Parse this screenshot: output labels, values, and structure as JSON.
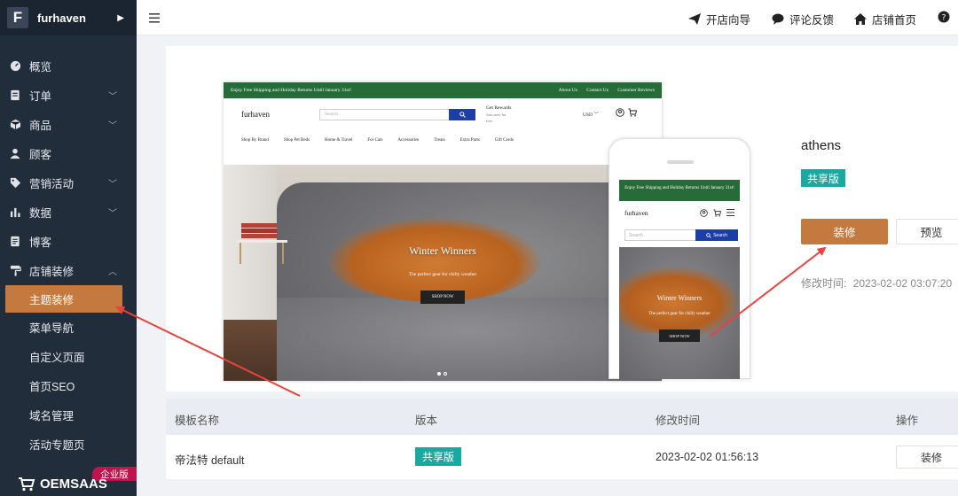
{
  "brand": {
    "logo_letter": "F",
    "name": "furhaven"
  },
  "sidebar": {
    "items": [
      {
        "label": "概览",
        "icon": "dashboard-icon",
        "has_chevron": false
      },
      {
        "label": "订单",
        "icon": "orders-icon",
        "has_chevron": true
      },
      {
        "label": "商品",
        "icon": "products-icon",
        "has_chevron": true
      },
      {
        "label": "顾客",
        "icon": "customers-icon",
        "has_chevron": false
      },
      {
        "label": "营销活动",
        "icon": "marketing-tag-icon",
        "has_chevron": true
      },
      {
        "label": "数据",
        "icon": "data-chart-icon",
        "has_chevron": true
      },
      {
        "label": "博客",
        "icon": "blog-icon",
        "has_chevron": false
      },
      {
        "label": "店铺装修",
        "icon": "paint-roller-icon",
        "has_chevron": true,
        "expanded": true
      }
    ],
    "sub_items": [
      "主题装修",
      "菜单导航",
      "自定义页面",
      "首页SEO",
      "域名管理",
      "活动专题页"
    ],
    "active_sub": "主题装修",
    "enterprise_badge": "企业版",
    "footer_logo": "OEMSAAS"
  },
  "topbar": {
    "links": [
      "开店向导",
      "评论反馈",
      "店铺首页"
    ]
  },
  "preview": {
    "desktop": {
      "announcement": "Enjoy Free Shipping and Holiday Returns Until January 31st!",
      "top_links": [
        "About Us",
        "Contact Us",
        "Customer Reviews"
      ],
      "store_name": "furhaven",
      "search_placeholder": "Search",
      "rewards_title": "Get Rewards",
      "rewards_sub": "Join now for",
      "rewards_sub2": "free",
      "currency": "USD",
      "nav": [
        "Shop By Brand",
        "Shop Pet Beds",
        "Home & Travel",
        "For Cats",
        "Accessories",
        "Treats",
        "Extra Parts",
        "Gift Cards"
      ],
      "hero_title": "Winter Winners",
      "hero_sub": "The perfect gear for chilly weather",
      "hero_button": "SHOP NOW"
    },
    "mobile": {
      "announcement": "Enjoy Free Shipping and Holiday Returns Until January 31st!",
      "store_name": "furhaven",
      "search_placeholder": "Search",
      "search_button": "Search",
      "hero_title": "Winter Winners",
      "hero_sub": "The perfect gear for chilly weather",
      "hero_button": "SHOP NOW"
    }
  },
  "theme": {
    "name": "athens",
    "badge": "共享版",
    "decorate_button": "装修",
    "preview_button": "预览",
    "modified_label": "修改时间:",
    "modified_value": "2023-02-02 03:07:20"
  },
  "table": {
    "headers": [
      "模板名称",
      "版本",
      "修改时间",
      "操作"
    ],
    "rows": [
      {
        "name": "帝法特 default",
        "version": "共享版",
        "modified": "2023-02-02 01:56:13",
        "action": "装修"
      }
    ]
  },
  "colors": {
    "sidebar_bg": "#222d3c",
    "accent": "#c4793e",
    "badge_teal": "#1aa9a0",
    "store_green": "#276b38",
    "store_blue": "#1b3fa6",
    "arrow_red": "#e8433e"
  }
}
